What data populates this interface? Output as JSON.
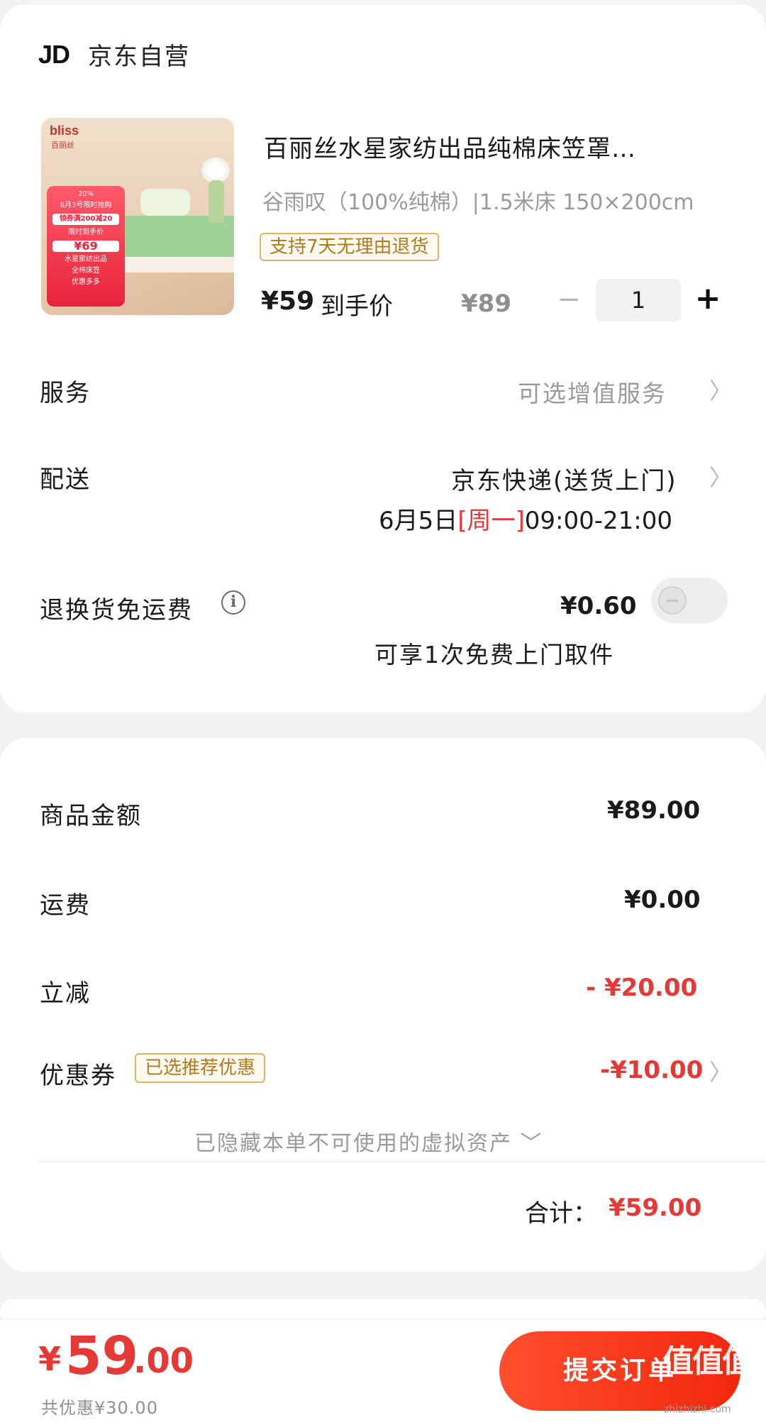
{
  "shop": {
    "logo_text": "JD",
    "name": "京东自营"
  },
  "product": {
    "image": {
      "brand": "bliss",
      "brand_cn": "百丽丝",
      "promo_lines": [
        "20%",
        "6月3号限时抢购",
        "领券满200减20",
        "限时到手价",
        "¥69",
        "水星家纺出品",
        "全棉床笠",
        "优惠多多"
      ]
    },
    "title": "百丽丝水星家纺出品纯棉床笠罩…",
    "spec": "谷雨叹（100%纯棉）|1.5米床 150×200cm",
    "return_tag": "支持7天无理由退货",
    "price_now": "¥59",
    "price_now_label": "到手价",
    "price_original": "¥89",
    "quantity": "1",
    "qty_minus": "−",
    "qty_plus": "+"
  },
  "service": {
    "label": "服务",
    "value": "可选增值服务"
  },
  "delivery": {
    "label": "配送",
    "method": "京东快递(送货上门)",
    "date": "6月5日",
    "weekday": "[周一]",
    "time": "09:00-21:00"
  },
  "return_fee": {
    "label": "退换货免运费",
    "price": "¥0.60",
    "note": "可享1次免费上门取件",
    "enabled": false
  },
  "summary": {
    "goods_label": "商品金额",
    "goods_value": "¥89.00",
    "shipping_label": "运费",
    "shipping_value": "¥0.00",
    "discount_label": "立减",
    "discount_value": "- ¥20.00",
    "coupon_label": "优惠券",
    "coupon_tag": "已选推荐优惠",
    "coupon_value": "-¥10.00",
    "hidden_assets": "已隐藏本单不可使用的虚拟资产 ﹀",
    "total_label": "合计：",
    "total_value": "¥59.00"
  },
  "bottom_bar": {
    "pay_yen": "¥",
    "pay_int": "59",
    "pay_dec": ".00",
    "saved_text": "共优惠¥30.00",
    "submit_label": "提交订单"
  },
  "watermark": {
    "text": "值值值",
    "url": "zhizhizhi.com"
  },
  "colors": {
    "accent": "#e53935",
    "submit_start": "#ff4f2e",
    "submit_end": "#f2270c",
    "tag_border": "#e0b36a",
    "tag_text": "#b07a20"
  }
}
